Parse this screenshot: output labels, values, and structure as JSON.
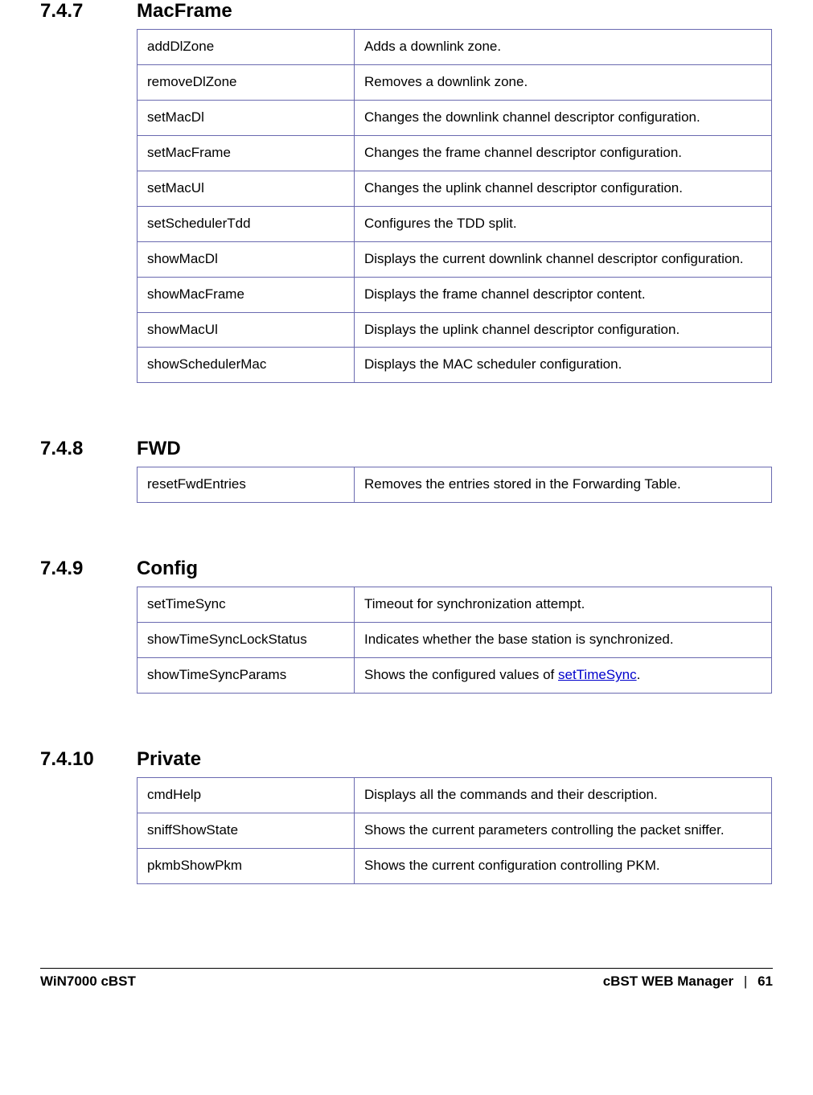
{
  "sections": [
    {
      "number": "7.4.7",
      "title": "MacFrame",
      "rows": [
        {
          "cmd": "addDlZone",
          "desc": "Adds a downlink zone."
        },
        {
          "cmd": "removeDlZone",
          "desc": "Removes a downlink zone."
        },
        {
          "cmd": "setMacDl",
          "desc": "Changes the downlink channel descriptor configuration."
        },
        {
          "cmd": "setMacFrame",
          "desc": "Changes the frame channel descriptor configuration."
        },
        {
          "cmd": "setMacUl",
          "desc": "Changes the uplink channel descriptor configuration."
        },
        {
          "cmd": "setSchedulerTdd",
          "desc": "Configures the TDD split."
        },
        {
          "cmd": "showMacDl",
          "desc": "Displays the current downlink channel descriptor configuration."
        },
        {
          "cmd": "showMacFrame",
          "desc": "Displays the frame channel descriptor content."
        },
        {
          "cmd": "showMacUl",
          "desc": "Displays the uplink channel descriptor configuration."
        },
        {
          "cmd": "showSchedulerMac",
          "desc": "Displays the MAC scheduler configuration."
        }
      ]
    },
    {
      "number": "7.4.8",
      "title": "FWD",
      "rows": [
        {
          "cmd": "resetFwdEntries",
          "desc": "Removes the entries stored in the Forwarding Table."
        }
      ]
    },
    {
      "number": "7.4.9",
      "title": "Config",
      "rows": [
        {
          "cmd": "setTimeSync",
          "desc": "Timeout for synchronization attempt."
        },
        {
          "cmd": "showTimeSyncLockStatus",
          "desc": "Indicates whether the base station is synchronized."
        },
        {
          "cmd": "showTimeSyncParams",
          "desc_pre": "Shows the configured values of ",
          "link_text": "setTimeSync",
          "desc_post": "."
        }
      ]
    },
    {
      "number": "7.4.10",
      "title": "Private",
      "rows": [
        {
          "cmd": "cmdHelp",
          "desc": "Displays all the commands and their description."
        },
        {
          "cmd": "sniffShowState",
          "desc": "Shows the current parameters controlling the packet sniffer."
        },
        {
          "cmd": "pkmbShowPkm",
          "desc": "Shows the current configuration controlling PKM."
        }
      ]
    }
  ],
  "footer": {
    "left": "WiN7000 cBST",
    "right_title": "cBST WEB Manager",
    "sep": "|",
    "page": "61"
  }
}
